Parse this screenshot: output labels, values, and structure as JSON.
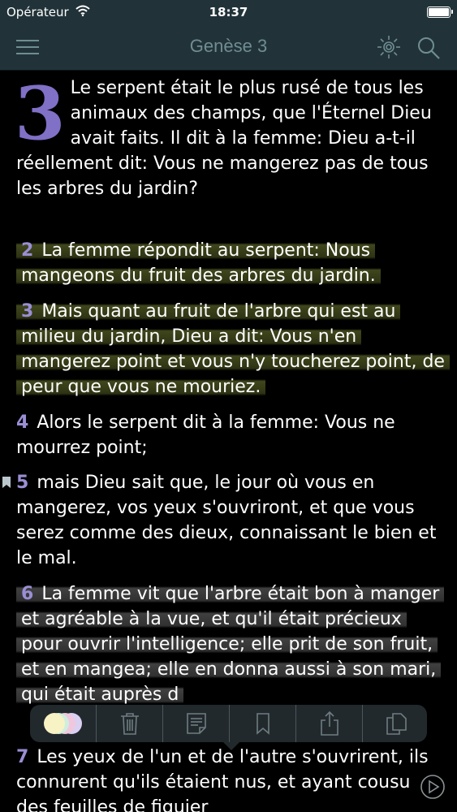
{
  "status_bar": {
    "carrier": "Opérateur",
    "time": "18:37"
  },
  "nav": {
    "title": "Genèse 3",
    "icons": [
      "menu-icon",
      "brightness-icon",
      "search-icon"
    ]
  },
  "chapter": {
    "dropcap": "3",
    "verses": [
      {
        "num": "",
        "text": "Le serpent était le plus rusé de tous les animaux des champs, que l'Éternel Dieu avait faits. Il dit à la femme: Dieu a-t-il réellement dit: Vous ne mangerez pas de tous les arbres du jardin?",
        "highlight": "none"
      },
      {
        "num": "2",
        "text": "La femme répondit au serpent: Nous mangeons du fruit des arbres du jardin.",
        "highlight": "yellow"
      },
      {
        "num": "3",
        "text": "Mais quant au fruit de l'arbre qui est au milieu du jardin, Dieu a dit: Vous n'en mangerez point et vous n'y toucherez point, de peur que vous ne mouriez.",
        "highlight": "yellow"
      },
      {
        "num": "4",
        "text": "Alors le serpent dit à la femme: Vous ne mourrez point;",
        "highlight": "none"
      },
      {
        "num": "5",
        "text": "mais Dieu sait que, le jour où vous en mangerez, vos yeux s'ouvriront, et que vous serez comme des dieux, connaissant le bien et le mal.",
        "highlight": "none",
        "bookmarked": true
      },
      {
        "num": "6",
        "text": "La femme vit que l'arbre était bon à manger et agréable à la vue, et qu'il était précieux pour ouvrir l'intelligence; elle prit de son fruit, et en mangea; elle en donna aussi à son mari, qui était auprès d",
        "highlight": "gray"
      },
      {
        "num": "7",
        "text": "Les yeux de l'un et de l'autre s'ouvrirent, ils connurent qu'ils étaient nus, et ayant cousu des feuilles de figuier",
        "highlight": "none"
      }
    ]
  },
  "toolbar": {
    "items": [
      "color-picker-icon",
      "trash-icon",
      "note-icon",
      "bookmark-icon",
      "share-icon",
      "copy-icon"
    ]
  },
  "colors": {
    "bar": "#213339",
    "bar_text": "#6f8d92",
    "verse_number": "#9a8ed4",
    "dropcap": "#8070c6",
    "highlight_yellow": "#5a6428",
    "highlight_gray": "#555555"
  }
}
